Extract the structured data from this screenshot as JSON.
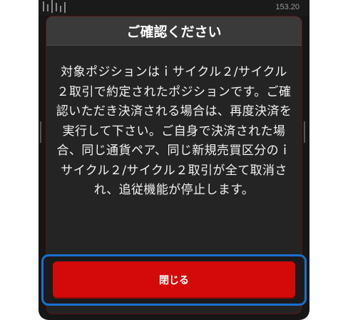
{
  "background": {
    "price_label": "153.20"
  },
  "dialog": {
    "title": "ご確認ください",
    "message": "対象ポジションはｉサイクル２/サイクル２取引で約定されたポジションです。ご確認いただき決済される場合は、再度決済を実行して下さい。ご自身で決済された場合、同じ通貨ペア、同じ新規売買区分のｉサイクル２/サイクル２取引が全て取消され、追従機能が停止します。",
    "close_label": "閉じる"
  },
  "colors": {
    "accent_red": "#d40a0a",
    "focus_blue": "#1a6fd0",
    "dialog_bg": "#242424",
    "header_bg": "#3a3a3a"
  }
}
